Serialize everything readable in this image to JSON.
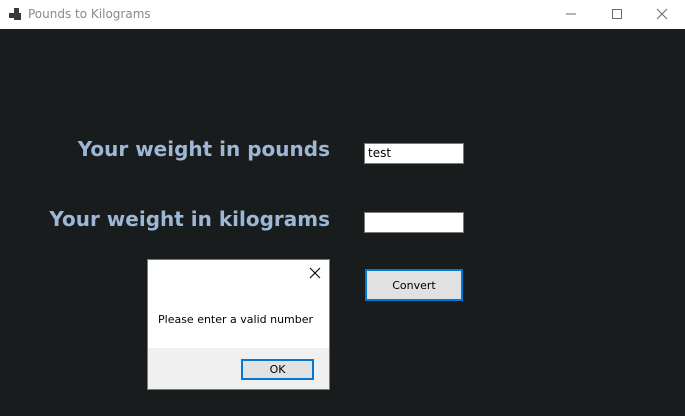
{
  "window": {
    "title": "Pounds to Kilograms",
    "icons": {
      "app": "app-icon",
      "minimize": "minimize-icon",
      "maximize": "maximize-icon",
      "close": "close-icon"
    }
  },
  "form": {
    "pounds_label": "Your weight in pounds",
    "pounds_value": "test",
    "kilograms_label": "Your weight in kilograms",
    "kilograms_value": "",
    "convert_label": "Convert"
  },
  "dialog": {
    "message": "Please enter a valid number",
    "ok_label": "OK",
    "close_icon": "close-icon"
  },
  "colors": {
    "background": "#191c1c",
    "label": "#9db7d6",
    "accent": "#0078d7"
  }
}
